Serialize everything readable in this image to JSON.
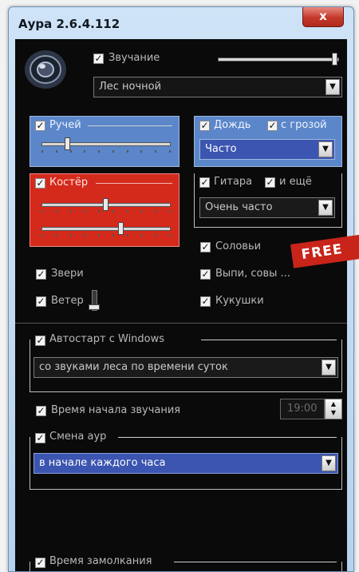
{
  "window": {
    "title": "Аура 2.6.4.112",
    "close_glyph": "x"
  },
  "sound": {
    "label": "Звучание",
    "checked": "✓",
    "volume": 0.97,
    "preset": "Лес ночной"
  },
  "stream": {
    "label": "Ручей",
    "checked": "✓",
    "level": 0.2
  },
  "rain": {
    "label": "Дождь",
    "checked": "✓",
    "thunder_label": "с грозой",
    "thunder_checked": "✓",
    "frequency": "Часто"
  },
  "fire": {
    "label": "Костёр",
    "checked": "✓",
    "level1": 0.5,
    "level2": 0.62
  },
  "guitar": {
    "label": "Гитара",
    "checked": "✓",
    "more_label": "и ещё",
    "more_checked": "✓",
    "frequency": "Очень часто"
  },
  "nightingales": {
    "label": "Соловьи",
    "checked": "✓"
  },
  "owls": {
    "label": "Выпи, совы ...",
    "checked": "✓"
  },
  "cuckoos": {
    "label": "Кукушки",
    "checked": "✓"
  },
  "animals": {
    "label": "Звери",
    "checked": "✓"
  },
  "wind": {
    "label": "Ветер",
    "checked": "✓",
    "level": 0.1
  },
  "free_banner": "FREE",
  "autostart": {
    "label": "Автостарт с Windows",
    "checked": "✓",
    "option": "со звуками леса по времени суток"
  },
  "start_time": {
    "label": "Время начала звучания",
    "checked": "✓",
    "value": "19:00"
  },
  "aura_change": {
    "label": "Смена аур",
    "checked": "✓",
    "option": "в начале каждого часа"
  },
  "silence": {
    "label": "Время замолкания",
    "checked": "✓"
  },
  "colors": {
    "stream_group": "#5b86c9",
    "fire_group": "#d42a1c",
    "selected": "#3b55b0"
  }
}
